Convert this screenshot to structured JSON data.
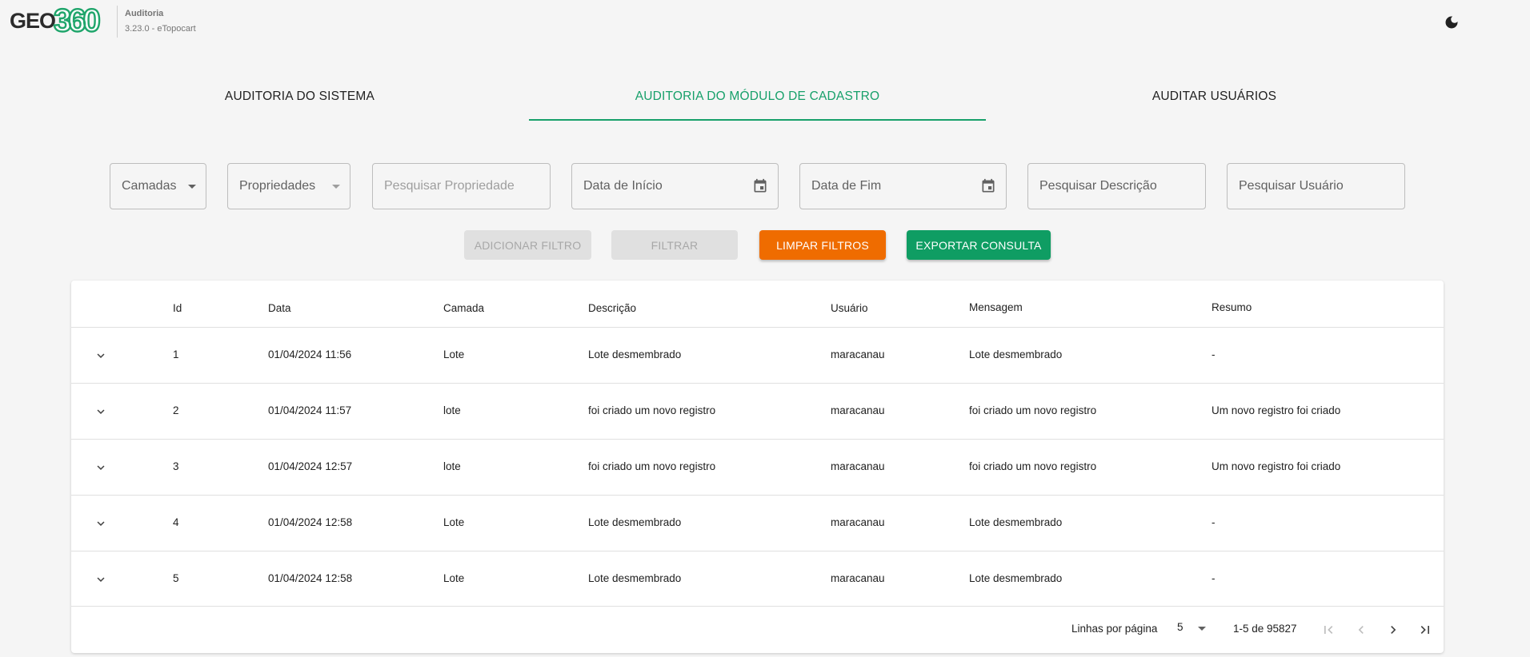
{
  "header": {
    "logo_geo": "GEO",
    "logo_num": "360",
    "app_title": "Auditoria",
    "app_version": "3.23.0 - eTopocart"
  },
  "tabs": [
    {
      "label": "AUDITORIA DO SISTEMA",
      "active": false
    },
    {
      "label": "AUDITORIA DO MÓDULO DE CADASTRO",
      "active": true
    },
    {
      "label": "AUDITAR USUÁRIOS",
      "active": false
    }
  ],
  "filters": {
    "camadas": "Camadas",
    "propriedades": "Propriedades",
    "pesquisar_propriedade": "Pesquisar Propriedade",
    "data_inicio": "Data de Início",
    "data_fim": "Data de Fim",
    "pesquisar_descricao": "Pesquisar Descrição",
    "pesquisar_usuario": "Pesquisar Usuário"
  },
  "buttons": {
    "adicionar": "ADICIONAR FILTRO",
    "filtrar": "FILTRAR",
    "limpar": "LIMPAR FILTROS",
    "exportar": "EXPORTAR CONSULTA"
  },
  "table": {
    "headers": [
      "Id",
      "Data",
      "Camada",
      "Descrição",
      "Usuário",
      "Mensagem",
      "Resumo"
    ],
    "rows": [
      [
        "1",
        "01/04/2024 11:56",
        "Lote",
        "Lote desmembrado",
        "maracanau",
        "Lote desmembrado",
        "-"
      ],
      [
        "2",
        "01/04/2024 11:57",
        "lote",
        "foi criado um novo registro",
        "maracanau",
        "foi criado um novo registro",
        "Um novo registro foi criado"
      ],
      [
        "3",
        "01/04/2024 12:57",
        "lote",
        "foi criado um novo registro",
        "maracanau",
        "foi criado um novo registro",
        "Um novo registro foi criado"
      ],
      [
        "4",
        "01/04/2024 12:58",
        "Lote",
        "Lote desmembrado",
        "maracanau",
        "Lote desmembrado",
        "-"
      ],
      [
        "5",
        "01/04/2024 12:58",
        "Lote",
        "Lote desmembrado",
        "maracanau",
        "Lote desmembrado",
        "-"
      ]
    ]
  },
  "pagination": {
    "rows_label": "Linhas por página",
    "rows_per_page": "5",
    "range": "1-5 de 95827"
  },
  "colors": {
    "accent": "#17a06a",
    "clear_button": "#ef6c00",
    "export_button": "#0f9d63"
  },
  "icons": [
    "moon-icon",
    "caret-down-icon",
    "calendar-icon",
    "chevron-down-icon",
    "first-page-icon",
    "prev-page-icon",
    "next-page-icon",
    "last-page-icon"
  ]
}
